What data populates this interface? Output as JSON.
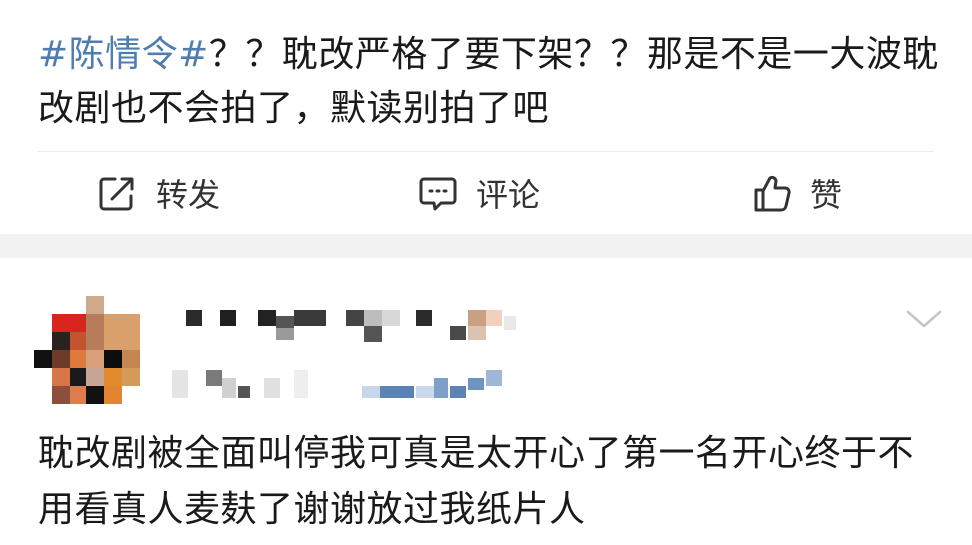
{
  "post": {
    "hashtag": "#陈情令#",
    "text": "？？耽改严格了要下架？？那是不是一大波耽改剧也不会拍了，默读别拍了吧"
  },
  "actions": {
    "repost": {
      "label": "转发",
      "icon": "share-icon"
    },
    "comment": {
      "label": "评论",
      "icon": "comment-icon"
    },
    "like": {
      "label": "赞",
      "icon": "thumbs-up-icon"
    }
  },
  "comment": {
    "text": "耽改剧被全面叫停我可真是太开心了第一名开心终于不用看真人麦麸了谢谢放过我纸片人"
  },
  "colors": {
    "hashtag": "#507daf",
    "text": "#1a1a1a",
    "icon": "#333333",
    "separator_band": "#f2f2f2"
  }
}
